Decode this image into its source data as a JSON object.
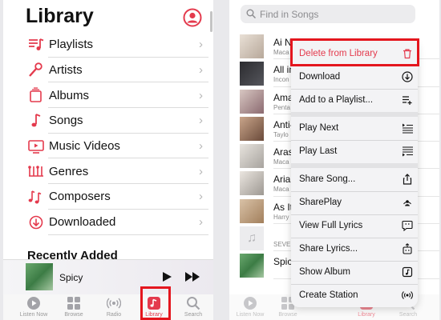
{
  "left": {
    "title": "Library",
    "items": [
      {
        "label": "Playlists",
        "icon": "playlist-icon"
      },
      {
        "label": "Artists",
        "icon": "microphone-icon"
      },
      {
        "label": "Albums",
        "icon": "album-icon"
      },
      {
        "label": "Songs",
        "icon": "music-note-icon"
      },
      {
        "label": "Music Videos",
        "icon": "tv-icon"
      },
      {
        "label": "Genres",
        "icon": "genres-icon"
      },
      {
        "label": "Composers",
        "icon": "composers-icon"
      },
      {
        "label": "Downloaded",
        "icon": "download-icon"
      }
    ],
    "recently_added": "Recently Added",
    "now_playing": "Spicy",
    "tabs": [
      {
        "label": "Listen Now",
        "icon": "play-circle-icon"
      },
      {
        "label": "Browse",
        "icon": "grid-icon"
      },
      {
        "label": "Radio",
        "icon": "radio-icon"
      },
      {
        "label": "Library",
        "icon": "library-icon"
      },
      {
        "label": "Search",
        "icon": "search-icon"
      }
    ],
    "active_tab": "Library"
  },
  "right": {
    "search_placeholder": "Find in Songs",
    "songs": [
      {
        "title": "Ai N",
        "subtitle": "Maca"
      },
      {
        "title": "All in",
        "subtitle": "Incon"
      },
      {
        "title": "Ama",
        "subtitle": "Penta"
      },
      {
        "title": "Anti-",
        "subtitle": "Taylo"
      },
      {
        "title": "Aras",
        "subtitle": "Maca"
      },
      {
        "title": "Arian",
        "subtitle": "Maca"
      },
      {
        "title": "As It",
        "subtitle": "Harry"
      },
      {
        "title": "",
        "subtitle": "SEVE"
      },
      {
        "title": "Spicy",
        "subtitle": ""
      }
    ],
    "menu": [
      {
        "label": "Delete from Library",
        "icon": "trash-icon",
        "danger": true
      },
      {
        "label": "Download",
        "icon": "download-circle-icon"
      },
      {
        "label": "Add to a Playlist...",
        "icon": "add-playlist-icon"
      },
      {
        "label": "Play Next",
        "icon": "play-next-icon"
      },
      {
        "label": "Play Last",
        "icon": "play-last-icon"
      },
      {
        "label": "Share Song...",
        "icon": "share-icon"
      },
      {
        "label": "SharePlay",
        "icon": "shareplay-icon"
      },
      {
        "label": "View Full Lyrics",
        "icon": "lyrics-icon"
      },
      {
        "label": "Share Lyrics...",
        "icon": "share-lyrics-icon"
      },
      {
        "label": "Show Album",
        "icon": "album-square-icon"
      },
      {
        "label": "Create Station",
        "icon": "station-icon"
      }
    ],
    "tabs": [
      {
        "label": "Listen Now"
      },
      {
        "label": "Browse"
      },
      {
        "label": "Library"
      },
      {
        "label": "Search"
      }
    ]
  },
  "colors": {
    "accent": "#e43a4d",
    "highlight": "#e4161e"
  }
}
